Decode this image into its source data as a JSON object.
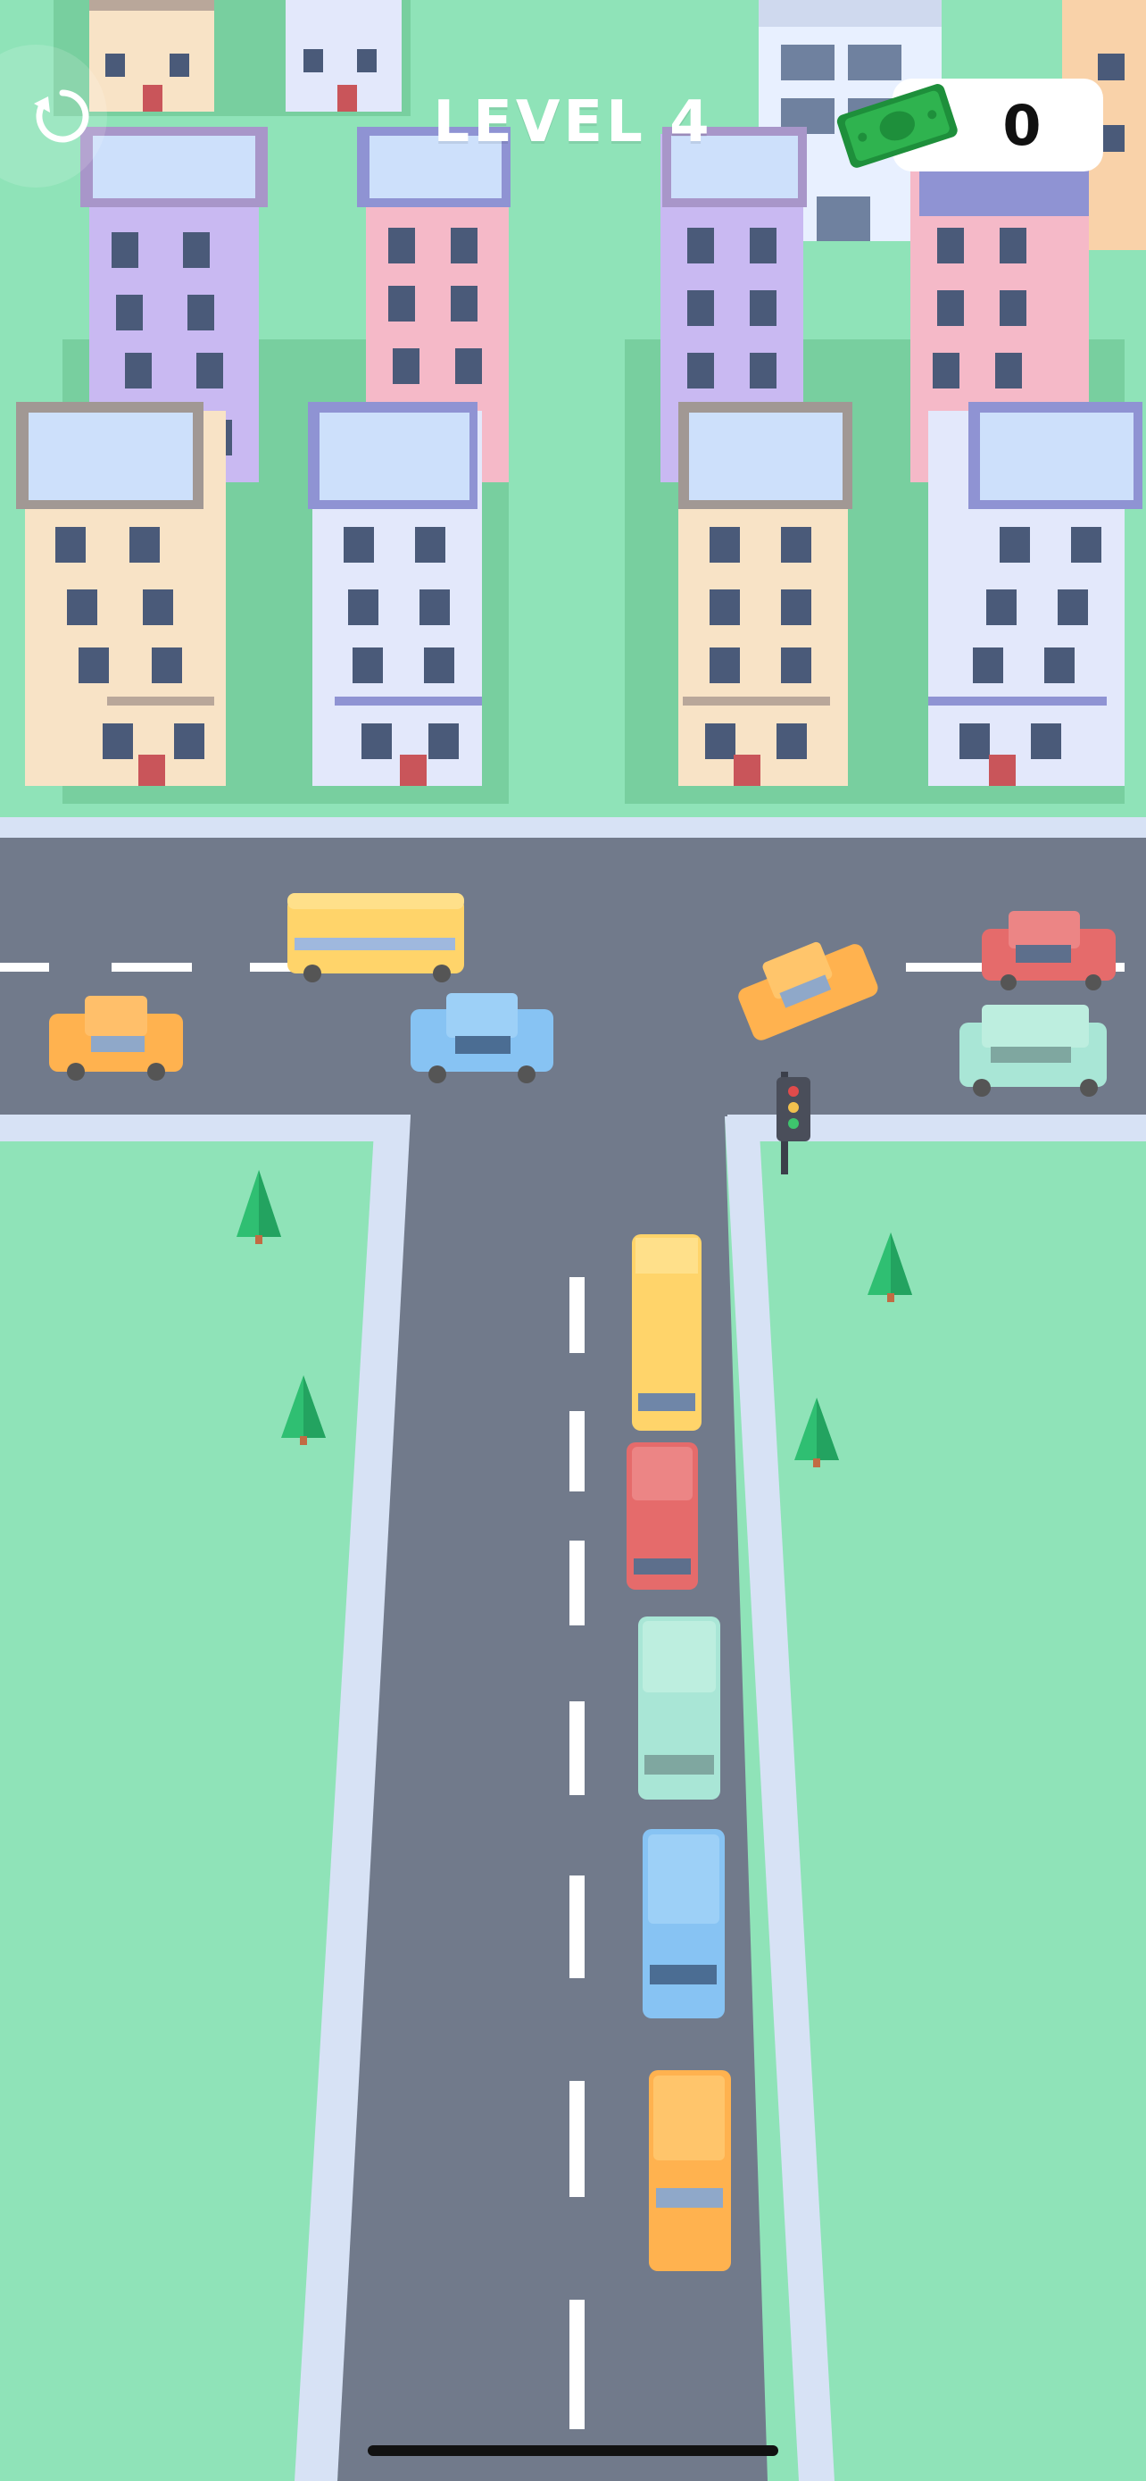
{
  "hud": {
    "level_label": "LEVEL 4",
    "cash_value": "0",
    "restart_icon": "restart-arrow-icon",
    "cash_icon": "banknote-icon"
  },
  "colors": {
    "grass": "#8fe3b8",
    "road": "#717a8b",
    "sidewalk": "#d7e2f5",
    "lane_marking": "#ffffff",
    "cash_green": "#2fb34f",
    "bus_yellow": "#ffd46a",
    "car_red": "#e56b6b",
    "car_mint": "#a9e6d6",
    "car_blue": "#87c3f3",
    "car_orange": "#ffb24f"
  },
  "game": {
    "queue_vehicles": [
      "bus",
      "red-car",
      "mint-van",
      "blue-car",
      "orange-car"
    ],
    "traffic_vehicles": [
      "orange-car",
      "yellow-bus",
      "blue-car",
      "orange-car",
      "red-car",
      "mint-car"
    ],
    "traffic_light_icon": "traffic-light-icon",
    "tree_icon": "pine-tree-icon"
  }
}
